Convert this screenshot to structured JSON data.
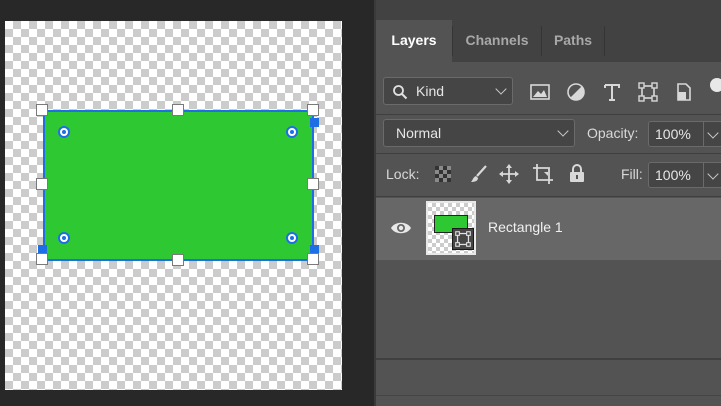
{
  "layer": {
    "name": "Rectangle 1"
  },
  "panel": {
    "tabs": [
      {
        "label": "Layers",
        "active": true
      },
      {
        "label": "Channels",
        "active": false
      },
      {
        "label": "Paths",
        "active": false
      }
    ],
    "filter": {
      "label": "Kind",
      "icon": "search-icon"
    },
    "blend_mode": "Normal",
    "opacity_label": "Opacity:",
    "opacity_value": "100%",
    "lock_label": "Lock:",
    "fill_label": "Fill:",
    "fill_value": "100%"
  },
  "colors": {
    "shape_fill": "#2ec932",
    "selection": "#1e6fe6",
    "panel_bg": "#535353",
    "selected_row": "#676767"
  }
}
